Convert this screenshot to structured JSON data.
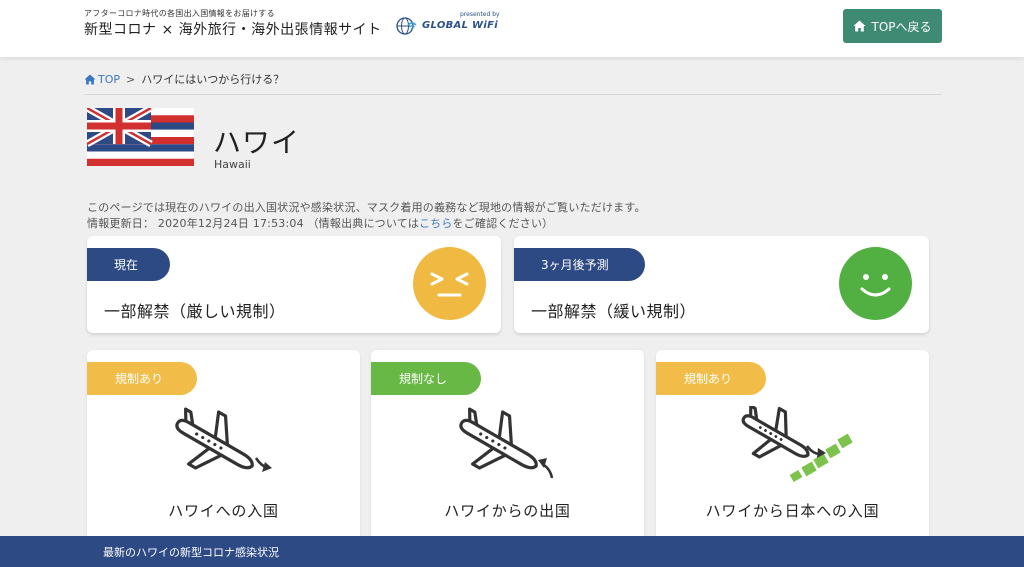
{
  "header": {
    "tagline": "アフターコロナ時代の各国出入国情報をお届けする",
    "title": "新型コロナ × 海外旅行・海外出張情報サイト",
    "presented_by": "presented by",
    "brand_name": "GLOBAL WiFi",
    "top_button_label": "TOPへ戻る"
  },
  "breadcrumb": {
    "home_label": "TOP",
    "separator": ">",
    "current": "ハワイにはいつから行ける？"
  },
  "country": {
    "name": "ハワイ",
    "name_en": "Hawaii",
    "description": "このページでは現在のハワイの出入国状況や感染状況、マスク着用の義務など現地の情報がご覧いただけます。",
    "updated_prefix": "情報更新日： 2020年12月24日 17:53:04 （情報出典については",
    "updated_link": "こちら",
    "updated_suffix": "をご確認ください）"
  },
  "status": {
    "now": {
      "tag": "現在",
      "text": "一部解禁（厳しい規制）",
      "face_icon": "frustrated-face-icon",
      "color": "#f0b941"
    },
    "future": {
      "tag": "3ヶ月後予測",
      "text": "一部解禁（緩い規制）",
      "face_icon": "smile-face-icon",
      "color": "#52b043"
    }
  },
  "categories": [
    {
      "tag": "規制あり",
      "tag_color": "#f2bc49",
      "label": "ハワイへの入国",
      "icon": "airplane-arrival-icon"
    },
    {
      "tag": "規制なし",
      "tag_color": "#68b845",
      "label": "ハワイからの出国",
      "icon": "airplane-departure-icon"
    },
    {
      "tag": "規制あり",
      "tag_color": "#f2bc49",
      "label": "ハワイから日本への入国",
      "icon": "airplane-japan-icon"
    }
  ],
  "footer": {
    "text": "最新のハワイの新型コロナ感染状況"
  },
  "colors": {
    "navy": "#2d4a85",
    "green_button": "#3e8a73",
    "link": "#3c78c0"
  }
}
